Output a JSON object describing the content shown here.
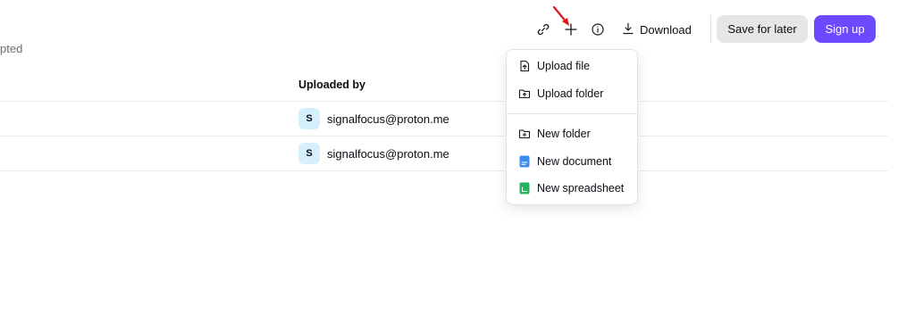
{
  "header": {
    "subtitle_fragment": "pted",
    "toolbar": {
      "copy_link_icon": "link-icon",
      "add_icon": "plus-icon",
      "info_icon": "info-icon",
      "download_label": "Download",
      "download_icon": "download-icon",
      "save_for_later_label": "Save for later",
      "sign_up_label": "Sign up"
    }
  },
  "table": {
    "column_header": "Uploaded by",
    "rows": [
      {
        "avatar_initial": "S",
        "uploaded_by": "signalfocus@proton.me"
      },
      {
        "avatar_initial": "S",
        "uploaded_by": "signalfocus@proton.me"
      }
    ]
  },
  "add_menu": {
    "items": [
      {
        "label": "Upload file",
        "icon": "upload-file-icon"
      },
      {
        "label": "Upload folder",
        "icon": "upload-folder-icon"
      },
      {
        "label": "New folder",
        "icon": "new-folder-icon"
      },
      {
        "label": "New document",
        "icon": "document-icon"
      },
      {
        "label": "New spreadsheet",
        "icon": "spreadsheet-icon"
      }
    ]
  },
  "colors": {
    "accent": "#6d4aff",
    "secondary_button_bg": "#e8e6e5",
    "avatar_bg": "#d6effc",
    "annotation_arrow": "#e0131a",
    "document_icon": "#3f8cf0",
    "spreadsheet_icon": "#1fb35b"
  }
}
